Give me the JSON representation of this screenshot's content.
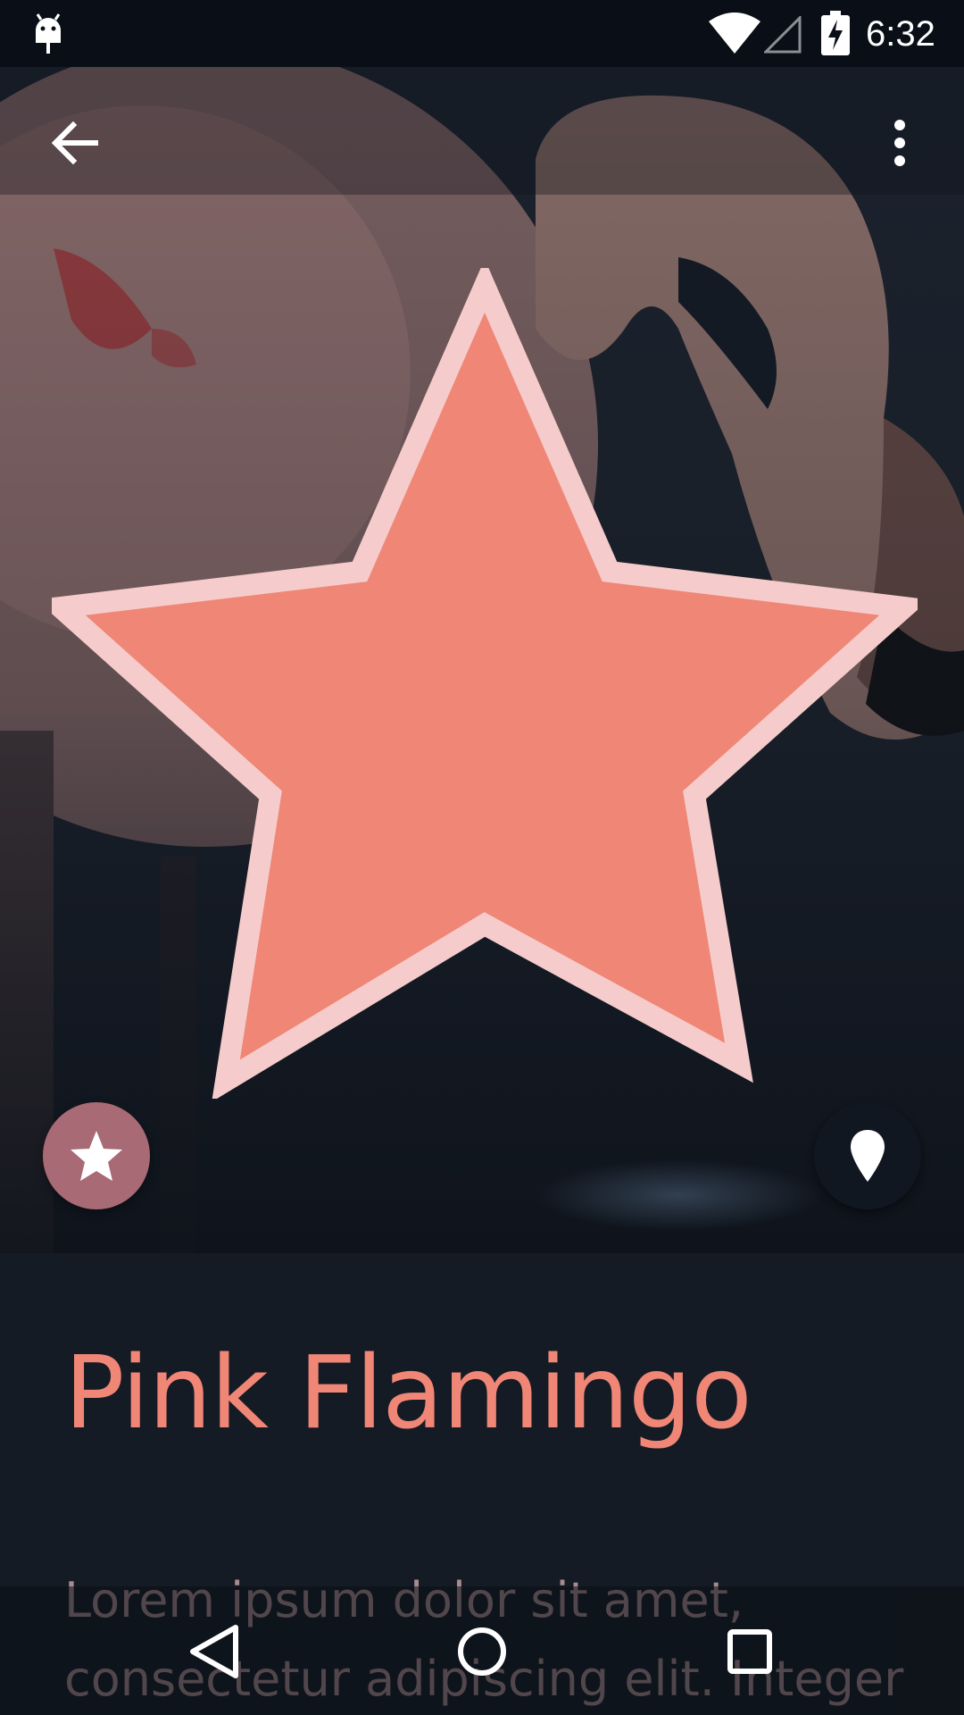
{
  "status_bar": {
    "time": "6:32",
    "left_icon": "android-debug-icon",
    "wifi_icon": "wifi-icon",
    "signal_icon": "signal-icon",
    "battery_icon": "battery-charging-icon"
  },
  "app_bar": {
    "back_icon": "arrow-back-icon",
    "overflow_icon": "more-vert-icon"
  },
  "hero": {
    "image": "flamingo-photo",
    "overlay_icon": "star-icon",
    "star_fill": "#ef8676",
    "star_stroke": "#f5cccb"
  },
  "fabs": {
    "favorite_icon": "star-icon",
    "favorite_color": "#a86a74",
    "location_icon": "place-icon",
    "location_color": "#111720"
  },
  "content": {
    "title": "Pink Flamingo",
    "body": "Lorem ipsum dolor sit amet, consectetur adipiscing elit. Integer",
    "title_color": "#f08676",
    "body_color": "#a88b8f"
  },
  "nav_bar": {
    "back_icon": "nav-back-icon",
    "home_icon": "nav-home-icon",
    "recents_icon": "nav-recents-icon"
  }
}
